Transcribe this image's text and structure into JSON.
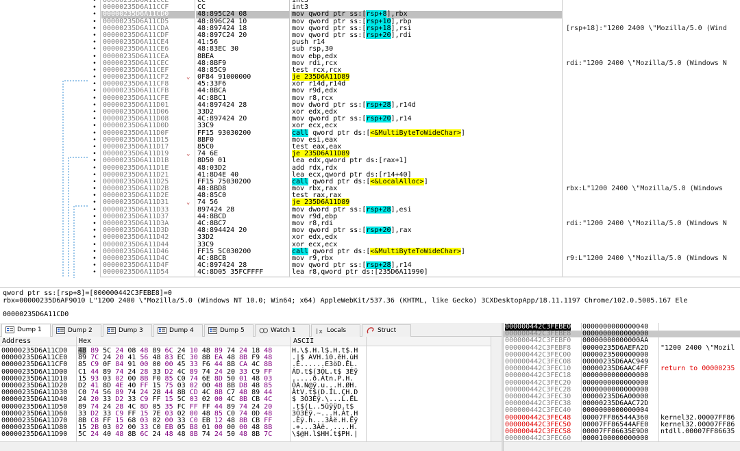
{
  "disasm": {
    "rows": [
      {
        "addr": "00000235D6A11CCE",
        "bytes": "CC",
        "instr": "int3",
        "comment": "",
        "bp": "•",
        "jmp": "",
        "sel": false
      },
      {
        "addr": "00000235D6A11CCF",
        "bytes": "CC",
        "instr": "int3",
        "comment": "",
        "bp": "•",
        "jmp": "",
        "sel": false
      },
      {
        "addr": "00000235D6A11CD0",
        "bytes": "48:895C24 08",
        "instr": "mov qword ptr ss:[rsp+8],rbx",
        "comment": "",
        "bp": "•",
        "jmp": "",
        "sel": true,
        "cur": true
      },
      {
        "addr": "00000235D6A11CD5",
        "bytes": "48:896C24 10",
        "instr": "mov qword ptr ss:[rsp+10],rbp",
        "comment": "",
        "bp": "•",
        "jmp": "",
        "sel": false
      },
      {
        "addr": "00000235D6A11CDA",
        "bytes": "48:897424 18",
        "instr": "mov qword ptr ss:[rsp+18],rsi",
        "comment": "[rsp+18]:\"1200 2400 \\\"Mozilla/5.0 (Wind",
        "bp": "•",
        "jmp": "",
        "sel": false
      },
      {
        "addr": "00000235D6A11CDF",
        "bytes": "48:897C24 20",
        "instr": "mov qword ptr ss:[rsp+20],rdi",
        "comment": "",
        "bp": "•",
        "jmp": "",
        "sel": false
      },
      {
        "addr": "00000235D6A11CE4",
        "bytes": "41:56",
        "instr": "push r14",
        "comment": "",
        "bp": "•",
        "jmp": "",
        "sel": false
      },
      {
        "addr": "00000235D6A11CE6",
        "bytes": "48:83EC 30",
        "instr": "sub rsp,30",
        "comment": "",
        "bp": "•",
        "jmp": "",
        "sel": false
      },
      {
        "addr": "00000235D6A11CEA",
        "bytes": "8BEA",
        "instr": "mov ebp,edx",
        "comment": "",
        "bp": "•",
        "jmp": "",
        "sel": false
      },
      {
        "addr": "00000235D6A11CEC",
        "bytes": "48:8BF9",
        "instr": "mov rdi,rcx",
        "comment": "rdi:\"1200 2400 \\\"Mozilla/5.0 (Windows N",
        "bp": "•",
        "jmp": "",
        "sel": false
      },
      {
        "addr": "00000235D6A11CEF",
        "bytes": "48:85C9",
        "instr": "test rcx,rcx",
        "comment": "",
        "bp": "•",
        "jmp": "",
        "sel": false
      },
      {
        "addr": "00000235D6A11CF2",
        "bytes": "0F84 91000000",
        "instr": "je 235D6A11D89",
        "comment": "",
        "bp": "•",
        "jmp": "⌄",
        "sel": false
      },
      {
        "addr": "00000235D6A11CF8",
        "bytes": "45:33F6",
        "instr": "xor r14d,r14d",
        "comment": "",
        "bp": "•",
        "jmp": "",
        "sel": false
      },
      {
        "addr": "00000235D6A11CFB",
        "bytes": "44:8BCA",
        "instr": "mov r9d,edx",
        "comment": "",
        "bp": "•",
        "jmp": "",
        "sel": false
      },
      {
        "addr": "00000235D6A11CFE",
        "bytes": "4C:8BC1",
        "instr": "mov r8,rcx",
        "comment": "",
        "bp": "•",
        "jmp": "",
        "sel": false
      },
      {
        "addr": "00000235D6A11D01",
        "bytes": "44:897424 28",
        "instr": "mov dword ptr ss:[rsp+28],r14d",
        "comment": "",
        "bp": "•",
        "jmp": "",
        "sel": false
      },
      {
        "addr": "00000235D6A11D06",
        "bytes": "33D2",
        "instr": "xor edx,edx",
        "comment": "",
        "bp": "•",
        "jmp": "",
        "sel": false
      },
      {
        "addr": "00000235D6A11D08",
        "bytes": "4C:897424 20",
        "instr": "mov qword ptr ss:[rsp+20],r14",
        "comment": "",
        "bp": "•",
        "jmp": "",
        "sel": false
      },
      {
        "addr": "00000235D6A11D0D",
        "bytes": "33C9",
        "instr": "xor ecx,ecx",
        "comment": "",
        "bp": "•",
        "jmp": "",
        "sel": false
      },
      {
        "addr": "00000235D6A11D0F",
        "bytes": "FF15 93030200",
        "instr": "call qword ptr ds:[<&MultiByteToWideChar>]",
        "comment": "",
        "bp": "•",
        "jmp": "",
        "sel": false
      },
      {
        "addr": "00000235D6A11D15",
        "bytes": "8BF0",
        "instr": "mov esi,eax",
        "comment": "",
        "bp": "•",
        "jmp": "",
        "sel": false
      },
      {
        "addr": "00000235D6A11D17",
        "bytes": "85C0",
        "instr": "test eax,eax",
        "comment": "",
        "bp": "•",
        "jmp": "",
        "sel": false
      },
      {
        "addr": "00000235D6A11D19",
        "bytes": "74 6E",
        "instr": "je 235D6A11D89",
        "comment": "",
        "bp": "•",
        "jmp": "⌄",
        "sel": false
      },
      {
        "addr": "00000235D6A11D1B",
        "bytes": "8D50 01",
        "instr": "lea edx,qword ptr ds:[rax+1]",
        "comment": "",
        "bp": "•",
        "jmp": "",
        "sel": false
      },
      {
        "addr": "00000235D6A11D1E",
        "bytes": "48:03D2",
        "instr": "add rdx,rdx",
        "comment": "",
        "bp": "•",
        "jmp": "",
        "sel": false
      },
      {
        "addr": "00000235D6A11D21",
        "bytes": "41:8D4E 40",
        "instr": "lea ecx,qword ptr ds:[r14+40]",
        "comment": "",
        "bp": "•",
        "jmp": "",
        "sel": false
      },
      {
        "addr": "00000235D6A11D25",
        "bytes": "FF15 75030200",
        "instr": "call qword ptr ds:[<&LocalAlloc>]",
        "comment": "",
        "bp": "•",
        "jmp": "",
        "sel": false
      },
      {
        "addr": "00000235D6A11D2B",
        "bytes": "48:8BD8",
        "instr": "mov rbx,rax",
        "comment": "rbx:L\"1200 2400 \\\"Mozilla/5.0 (Windows",
        "bp": "•",
        "jmp": "",
        "sel": false
      },
      {
        "addr": "00000235D6A11D2E",
        "bytes": "48:85C0",
        "instr": "test rax,rax",
        "comment": "",
        "bp": "•",
        "jmp": "",
        "sel": false
      },
      {
        "addr": "00000235D6A11D31",
        "bytes": "74 56",
        "instr": "je 235D6A11D89",
        "comment": "",
        "bp": "•",
        "jmp": "⌄",
        "sel": false
      },
      {
        "addr": "00000235D6A11D33",
        "bytes": "897424 28",
        "instr": "mov dword ptr ss:[rsp+28],esi",
        "comment": "",
        "bp": "•",
        "jmp": "",
        "sel": false
      },
      {
        "addr": "00000235D6A11D37",
        "bytes": "44:8BCD",
        "instr": "mov r9d,ebp",
        "comment": "",
        "bp": "•",
        "jmp": "",
        "sel": false
      },
      {
        "addr": "00000235D6A11D3A",
        "bytes": "4C:8BC7",
        "instr": "mov r8,rdi",
        "comment": "rdi:\"1200 2400 \\\"Mozilla/5.0 (Windows N",
        "bp": "•",
        "jmp": "",
        "sel": false
      },
      {
        "addr": "00000235D6A11D3D",
        "bytes": "48:894424 20",
        "instr": "mov qword ptr ss:[rsp+20],rax",
        "comment": "",
        "bp": "•",
        "jmp": "",
        "sel": false
      },
      {
        "addr": "00000235D6A11D42",
        "bytes": "33D2",
        "instr": "xor edx,edx",
        "comment": "",
        "bp": "•",
        "jmp": "",
        "sel": false
      },
      {
        "addr": "00000235D6A11D44",
        "bytes": "33C9",
        "instr": "xor ecx,ecx",
        "comment": "",
        "bp": "•",
        "jmp": "",
        "sel": false
      },
      {
        "addr": "00000235D6A11D46",
        "bytes": "FF15 5C030200",
        "instr": "call qword ptr ds:[<&MultiByteToWideChar>]",
        "comment": "",
        "bp": "•",
        "jmp": "",
        "sel": false
      },
      {
        "addr": "00000235D6A11D4C",
        "bytes": "4C:8BCB",
        "instr": "mov r9,rbx",
        "comment": "r9:L\"1200 2400 \\\"Mozilla/5.0 (Windows N",
        "bp": "•",
        "jmp": "",
        "sel": false
      },
      {
        "addr": "00000235D6A11D4F",
        "bytes": "4C:897424 28",
        "instr": "mov qword ptr ss:[rsp+28],r14",
        "comment": "",
        "bp": "•",
        "jmp": "",
        "sel": false
      },
      {
        "addr": "00000235D6A11D54",
        "bytes": "4C:8D05 35FCFFFF",
        "instr": "lea r8,qword ptr ds:[235D6A11990]",
        "comment": "",
        "bp": "•",
        "jmp": "",
        "sel": false
      }
    ]
  },
  "info": {
    "line1": "qword ptr ss:[rsp+8]=[000000442C3FEBE8]=0",
    "line2": "rbx=00000235D6AF9010 L\"1200 2400 \\\"Mozilla/5.0 (Windows NT 10.0; Win64; x64) AppleWebKit/537.36 (KHTML, like Gecko) 3CXDesktopApp/18.11.1197 Chrome/102.0.5005.167 Ele",
    "line3": "00000235D6A11CD0"
  },
  "tabs": [
    {
      "label": "Dump 1",
      "icon": "dump-icon",
      "active": true
    },
    {
      "label": "Dump 2",
      "icon": "dump-icon",
      "active": false
    },
    {
      "label": "Dump 3",
      "icon": "dump-icon",
      "active": false
    },
    {
      "label": "Dump 4",
      "icon": "dump-icon",
      "active": false
    },
    {
      "label": "Dump 5",
      "icon": "dump-icon",
      "active": false
    },
    {
      "label": "Watch 1",
      "icon": "watch-icon",
      "active": false
    },
    {
      "label": "Locals",
      "icon": "locals-icon",
      "active": false
    },
    {
      "label": "Struct",
      "icon": "struct-icon",
      "active": false
    }
  ],
  "dump": {
    "headers": {
      "address": "Address",
      "hex": "Hex",
      "ascii": "ASCII"
    },
    "rows": [
      {
        "addr": "00000235D6A11CD0",
        "hex": "48 89 5C 24 08 48 89 6C 24 10 48 89 74 24 18 48",
        "ascii": "H.\\$.H.l$.H.t$.H"
      },
      {
        "addr": "00000235D6A11CE0",
        "hex": "89 7C 24 20 41 56 48 83 EC 30 8B EA 48 8B F9 48",
        "ascii": ".|$ AVH.ì0.êH.ùH"
      },
      {
        "addr": "00000235D6A11CF0",
        "hex": "85 C9 0F 84 91 00 00 00 45 33 F6 44 8B CA 4C 8B",
        "ascii": ".É......E3öD.ÊL."
      },
      {
        "addr": "00000235D6A11D00",
        "hex": "C1 44 89 74 24 28 33 D2 4C 89 74 24 20 33 C9 FF",
        "ascii": "ÁD.t$(3ÒL.t$ 3Éÿ"
      },
      {
        "addr": "00000235D6A11D10",
        "hex": "15 93 03 02 00 8B F0 85 C0 74 6E 8D 50 01 48 03",
        "ascii": ".....ð.Àtn.P.H."
      },
      {
        "addr": "00000235D6A11D20",
        "hex": "D2 41 8D 4E 40 FF 15 75 03 02 00 48 8B D8 48 85",
        "ascii": "ÒA.N@ÿ.u...H.ØH."
      },
      {
        "addr": "00000235D6A11D30",
        "hex": "C0 74 56 89 74 24 28 44 8B CD 4C 8B C7 48 89 44",
        "ascii": "ÀtV.t$(D.ÍL.ÇH.D"
      },
      {
        "addr": "00000235D6A11D40",
        "hex": "24 20 33 D2 33 C9 FF 15 5C 03 02 00 4C 8B CB 4C",
        "ascii": "$ 3Ò3Éÿ.\\...L.ËL"
      },
      {
        "addr": "00000235D6A11D50",
        "hex": "89 74 24 28 4C 8D 05 35 FC FF FF 44 89 74 24 20",
        "ascii": ".t$(L..5üÿÿD.t$ "
      },
      {
        "addr": "00000235D6A11D60",
        "hex": "33 D2 33 C9 FF 15 7E 03 02 00 48 85 C0 74 0D 48",
        "ascii": "3Ò3Éÿ.~...H.Àt.H"
      },
      {
        "addr": "00000235D6A11D70",
        "hex": "8B C8 FF 15 68 03 02 00 33 C0 EB 12 48 8B CB FF",
        "ascii": ".Èÿ.h...3Àë.H.Ëÿ"
      },
      {
        "addr": "00000235D6A11D80",
        "hex": "15 2B 03 02 00 33 C0 EB 05 B8 01 00 00 00 48 8B",
        "ascii": ".+...3Àë.¸....H."
      },
      {
        "addr": "00000235D6A11D90",
        "hex": "5C 24 40 48 8B 6C 24 48 48 8B 74 24 50 48 8B 7C",
        "ascii": "\\$@H.l$HH.t$PH.|"
      }
    ]
  },
  "stack": {
    "rows": [
      {
        "addr": "000000442C3FEBE0",
        "val": "0000000000000040",
        "cmt": "",
        "style": "cur"
      },
      {
        "addr": "000000442C3FEBE8",
        "val": "0000000000000000",
        "cmt": "",
        "style": "sel"
      },
      {
        "addr": "000000442C3FEBF0",
        "val": "00000000000000AA",
        "cmt": "",
        "style": ""
      },
      {
        "addr": "000000442C3FEBF8",
        "val": "00000235D6AEFA2D",
        "cmt": "\"1200 2400 \\\"Mozil",
        "style": ""
      },
      {
        "addr": "000000442C3FEC00",
        "val": "0000023500000000",
        "cmt": "",
        "style": ""
      },
      {
        "addr": "000000442C3FEC08",
        "val": "00000235D6AAC949",
        "cmt": "",
        "style": ""
      },
      {
        "addr": "000000442C3FEC10",
        "val": "00000235D6AAC4FF",
        "cmt": "return to 00000235",
        "style": "redcmt"
      },
      {
        "addr": "000000442C3FEC18",
        "val": "0000000000000000",
        "cmt": "",
        "style": ""
      },
      {
        "addr": "000000442C3FEC20",
        "val": "0000000000000000",
        "cmt": "",
        "style": ""
      },
      {
        "addr": "000000442C3FEC28",
        "val": "0000000000000000",
        "cmt": "",
        "style": ""
      },
      {
        "addr": "000000442C3FEC30",
        "val": "00000235D6A00000",
        "cmt": "",
        "style": ""
      },
      {
        "addr": "000000442C3FEC38",
        "val": "00000235D6AAC72D",
        "cmt": "",
        "style": ""
      },
      {
        "addr": "000000442C3FEC40",
        "val": "0000000000000004",
        "cmt": "",
        "style": ""
      },
      {
        "addr": "000000442C3FEC48",
        "val": "00007FF86544A360",
        "cmt": "kernel32.00007FF86",
        "style": "redaddr"
      },
      {
        "addr": "000000442C3FEC50",
        "val": "00007FF86544AFE0",
        "cmt": "kernel32.00007FF86",
        "style": "redaddr"
      },
      {
        "addr": "000000442C3FEC58",
        "val": "00007FF86635E9D0",
        "cmt": "ntdll.00007FF86635",
        "style": "redaddr"
      },
      {
        "addr": "000000442C3FEC60",
        "val": "0000100000000000",
        "cmt": "",
        "style": ""
      }
    ]
  },
  "colors": {
    "highlight_yellow": "#ffff00",
    "highlight_cyan": "#00e8e8",
    "red": "#e00000",
    "selection": "#c0c0c0"
  }
}
